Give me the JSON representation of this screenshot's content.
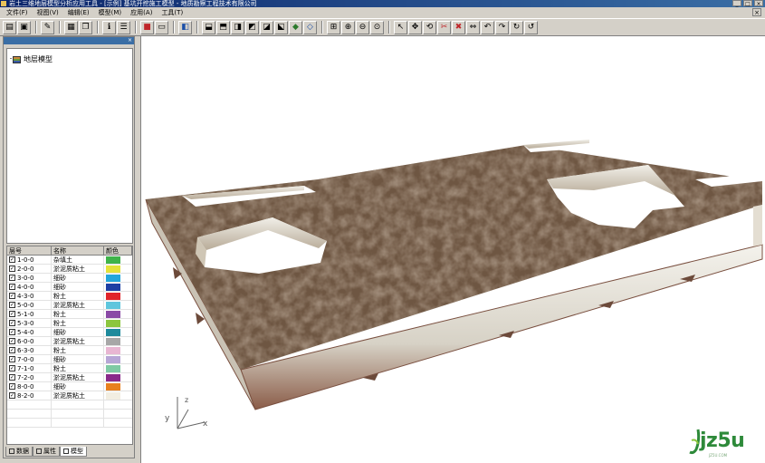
{
  "titlebar": {
    "title": "岩土三维地层模型分析应用工具 - [示例] 基坑开挖施工模型 - 地质勘察工程技术有限公司",
    "buttons": [
      "_",
      "□",
      "×"
    ]
  },
  "menu": {
    "items": [
      "文件(F)",
      "视图(V)",
      "编辑(E)",
      "模型(M)",
      "应用(A)",
      "工具(T)"
    ],
    "close_label": "×"
  },
  "tree": {
    "root_label": "地层模型"
  },
  "layer_table": {
    "headers": [
      "层号",
      "名称",
      "颜色"
    ],
    "rows": [
      {
        "code": "1-0-0",
        "name": "杂填土",
        "color": "#3fb34a",
        "checked": true
      },
      {
        "code": "2-0-0",
        "name": "淤泥质粘土",
        "color": "#e4e23a",
        "checked": true
      },
      {
        "code": "3-0-0",
        "name": "细砂",
        "color": "#23a6dc",
        "checked": true
      },
      {
        "code": "4-0-0",
        "name": "细砂",
        "color": "#1d3fa4",
        "checked": true
      },
      {
        "code": "4-3-0",
        "name": "粉土",
        "color": "#e0242a",
        "checked": true
      },
      {
        "code": "5-0-0",
        "name": "淤泥质粘土",
        "color": "#5ec6dd",
        "checked": true
      },
      {
        "code": "5-1-0",
        "name": "粉土",
        "color": "#8a4aa6",
        "checked": true
      },
      {
        "code": "5-3-0",
        "name": "粉土",
        "color": "#8cc63e",
        "checked": true
      },
      {
        "code": "5-4-0",
        "name": "细砂",
        "color": "#1e8a9c",
        "checked": true
      },
      {
        "code": "6-0-0",
        "name": "淤泥质粘土",
        "color": "#a7a7a7",
        "checked": true
      },
      {
        "code": "6-3-0",
        "name": "粉土",
        "color": "#e8b6d2",
        "checked": true
      },
      {
        "code": "7-0-0",
        "name": "细砂",
        "color": "#b7a6d6",
        "checked": true
      },
      {
        "code": "7-1-0",
        "name": "粉土",
        "color": "#7fcaa4",
        "checked": true
      },
      {
        "code": "7-2-0",
        "name": "淤泥质粘土",
        "color": "#8a2a8a",
        "checked": true
      },
      {
        "code": "8-0-0",
        "name": "细砂",
        "color": "#e8801e",
        "checked": true
      },
      {
        "code": "8-2-0",
        "name": "淤泥质粘土",
        "color": "#f2eee2",
        "checked": true
      }
    ]
  },
  "panel_tabs": [
    "数据",
    "属性",
    "模型"
  ],
  "viewport": {
    "axis_labels": {
      "x": "x",
      "y": "y",
      "z": "z"
    },
    "colors": {
      "soil_top": "#6e5642",
      "soil_dark": "#3d2c20",
      "slab_side": "#e9e5dc",
      "slab_edge": "#8a5c48",
      "hole_wall": "#d9d3c6"
    }
  },
  "watermark": {
    "text": "jz5u",
    "sub": "JZ5U.COM"
  }
}
